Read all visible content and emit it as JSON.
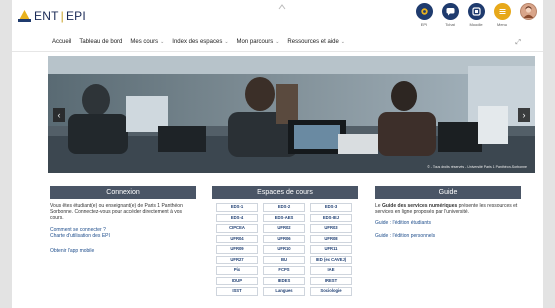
{
  "header": {
    "logo_ent": "ENT",
    "logo_sep": "|",
    "logo_epi": "EPI",
    "icons": [
      {
        "name": "epi-icon",
        "label": "EPI",
        "color": "#1f3b6e"
      },
      {
        "name": "tchat-icon",
        "label": "Tchat",
        "color": "#1f3b6e"
      },
      {
        "name": "moodle-icon",
        "label": "Moodle",
        "color": "#1f3b6e"
      },
      {
        "name": "menu-icon",
        "label": "Menu",
        "color": "#e7a81a"
      },
      {
        "name": "avatar",
        "label": "",
        "color": "#d9a58a"
      }
    ]
  },
  "nav": {
    "items": [
      {
        "label": "Accueil",
        "has_dropdown": false
      },
      {
        "label": "Tableau de bord",
        "has_dropdown": false
      },
      {
        "label": "Mes cours",
        "has_dropdown": true
      },
      {
        "label": "Index des espaces",
        "has_dropdown": true
      },
      {
        "label": "Mon parcours",
        "has_dropdown": true
      },
      {
        "label": "Ressources et aide",
        "has_dropdown": true
      }
    ],
    "chevron": "⌄",
    "expand_glyph": "⤢"
  },
  "carousel": {
    "prev": "‹",
    "next": "›",
    "credit": "© - Tous droits réservés - Université Paris 1 Panthéon-Sorbonne"
  },
  "connexion": {
    "title": "Connexion",
    "intro": "Vous êtes étudiant(e) ou enseignant(e) de Paris 1 Panthéon Sorbonne. Connectez-vous pour accéder directement à vos cours.",
    "link1": "Comment se connecter ?",
    "link2": "Charte d'utilisation des EPI",
    "app_link": "Obtenir l'app mobile"
  },
  "espaces": {
    "title": "Espaces de cours",
    "cells": [
      "EDS-1",
      "EDS-2",
      "EDS-3",
      "EDS-4",
      "EDS-AES",
      "EDS-IEJ",
      "CIPCEA",
      "UFR02",
      "UFR03",
      "UFR04",
      "UFR06",
      "UFR08",
      "UFR09",
      "UFR10",
      "UFR11",
      "UFR27",
      "BU",
      "IED (ex CAVEJ)",
      "Pix",
      "FCPS",
      "IAE",
      "IDUP",
      "IEDES",
      "IREST",
      "ISST",
      "Langues",
      "Sociologie"
    ]
  },
  "guide": {
    "title": "Guide",
    "intro_pre": "Le ",
    "intro_bold": "Guide des services numériques",
    "intro_post": " présente les ressources et services en ligne proposés par l'université.",
    "link1": "Guide : l'édition étudiants",
    "link2": "Guide : l'édition personnels"
  }
}
